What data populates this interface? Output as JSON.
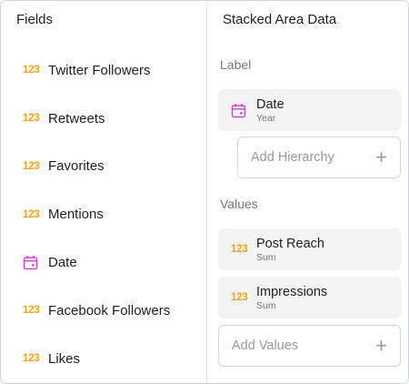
{
  "fields_pane": {
    "title": "Fields",
    "items": [
      {
        "icon": "number-icon",
        "icon_text": "123",
        "label": "Twitter Followers"
      },
      {
        "icon": "number-icon",
        "icon_text": "123",
        "label": "Retweets"
      },
      {
        "icon": "number-icon",
        "icon_text": "123",
        "label": "Favorites"
      },
      {
        "icon": "number-icon",
        "icon_text": "123",
        "label": "Mentions"
      },
      {
        "icon": "calendar-icon",
        "icon_text": "",
        "label": "Date"
      },
      {
        "icon": "number-icon",
        "icon_text": "123",
        "label": "Facebook Followers"
      },
      {
        "icon": "number-icon",
        "icon_text": "123",
        "label": "Likes"
      }
    ]
  },
  "data_pane": {
    "title": "Stacked Area Data",
    "label_section": {
      "heading": "Label",
      "chip": {
        "icon": "calendar-icon",
        "name": "Date",
        "aggregation": "Year"
      },
      "add_placeholder": "Add Hierarchy"
    },
    "values_section": {
      "heading": "Values",
      "chips": [
        {
          "icon": "number-icon",
          "icon_text": "123",
          "name": "Post Reach",
          "aggregation": "Sum"
        },
        {
          "icon": "number-icon",
          "icon_text": "123",
          "name": "Impressions",
          "aggregation": "Sum"
        }
      ],
      "add_placeholder": "Add Values"
    }
  },
  "colors": {
    "number_icon": "#f5a01a",
    "calendar_icon": "#d63fd6",
    "chip_bg": "#f3f3f3"
  }
}
